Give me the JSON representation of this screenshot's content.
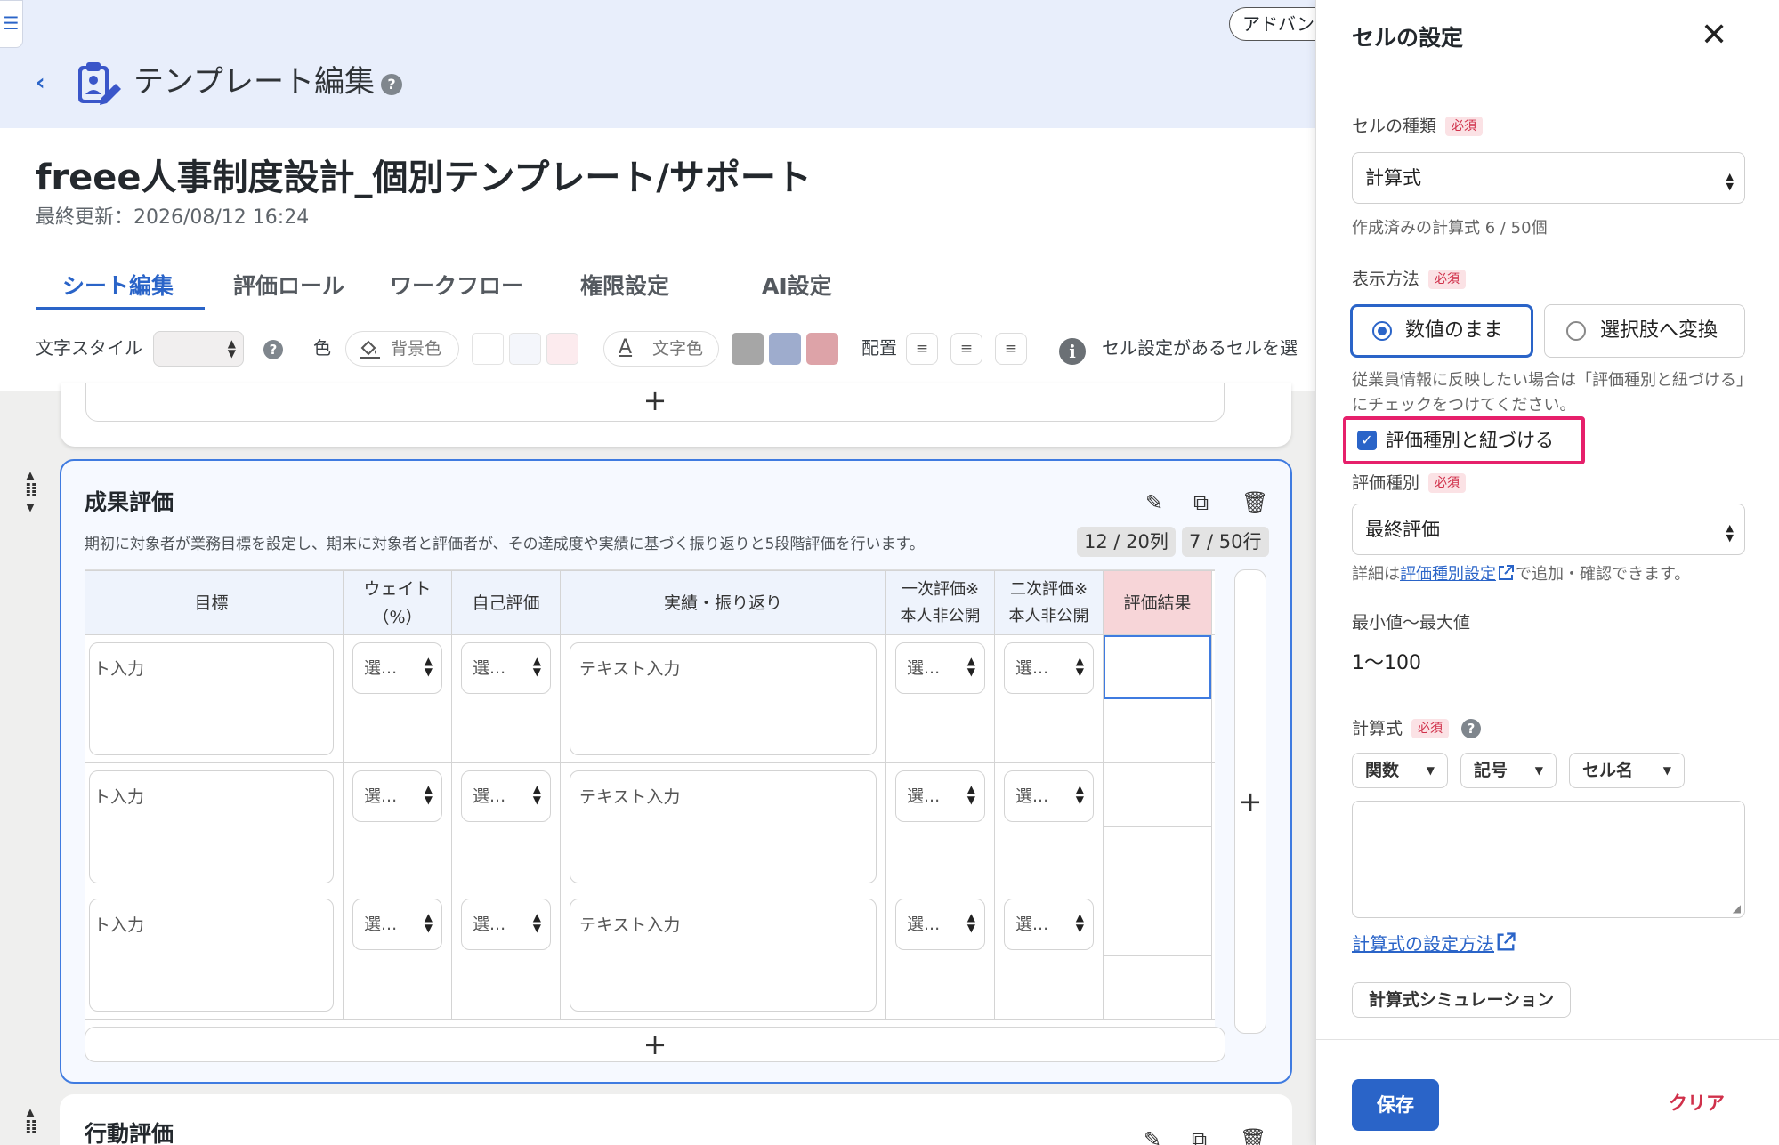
{
  "header": {
    "advanced_button": "アドバン",
    "page_title": "テンプレート編集",
    "doc_title": "freee人事制度設計_個別テンプレート/サポート",
    "last_updated": "最終更新：2026/08/12 16:24"
  },
  "tabs": [
    {
      "label": "シート編集",
      "active": true
    },
    {
      "label": "評価ロール",
      "active": false
    },
    {
      "label": "ワークフロー",
      "active": false
    },
    {
      "label": "権限設定",
      "active": false
    },
    {
      "label": "AI設定",
      "active": false
    }
  ],
  "toolbar": {
    "text_style_label": "文字スタイル",
    "color_label": "色",
    "bg_color_button": "背景色",
    "text_color_button": "文字色",
    "align_label": "配置",
    "info_text": "セル設定があるセルを選",
    "bg_swatches": [
      "#ffffff",
      "#f4f6fb",
      "#fcebee"
    ],
    "text_swatches": [
      "#a6a6a6",
      "#9eaccd",
      "#dda3a8"
    ]
  },
  "section": {
    "title": "成果評価",
    "description": "期初に対象者が業務目標を設定し、期末に対象者と評価者が、その達成度や実績に基づく振り返りと5段階評価を行います。",
    "columns_count": "12 / 20列",
    "rows_count": "7 / 50行",
    "columns": [
      "目標",
      "ウェイト\n（%）",
      "自己評価",
      "実績・振り返り",
      "一次評価※\n本人非公開",
      "二次評価※\n本人非公開",
      "評価結果"
    ],
    "text_placeholder": "テキスト入力",
    "goal_placeholder": "ト入力",
    "select_placeholder": "選..."
  },
  "next_section": {
    "title": "行動評価"
  },
  "panel": {
    "title": "セルの設定",
    "required": "必須",
    "cell_type_label": "セルの種類",
    "cell_type_value": "計算式",
    "cell_type_note": "作成済みの計算式 6 / 50個",
    "display_label": "表示方法",
    "radio_as_number": "数値のまま",
    "radio_to_choice": "選択肢へ変換",
    "link_note": "従業員情報に反映したい場合は「評価種別と紐づける」にチェックをつけてください。",
    "link_checkbox": "評価種別と紐づける",
    "eval_type_label": "評価種別",
    "eval_type_value": "最終評価",
    "eval_note_prefix": "詳細は",
    "eval_note_link": "評価種別設定",
    "eval_note_suffix": "で追加・確認できます。",
    "range_label": "最小値〜最大値",
    "range_value": "1〜100",
    "formula_label": "計算式",
    "btn_function": "関数",
    "btn_symbol": "記号",
    "btn_cell_name": "セル名",
    "formula_help_link": "計算式の設定方法",
    "simulation_button": "計算式シミュレーション",
    "save_button": "保存",
    "clear_button": "クリア"
  }
}
